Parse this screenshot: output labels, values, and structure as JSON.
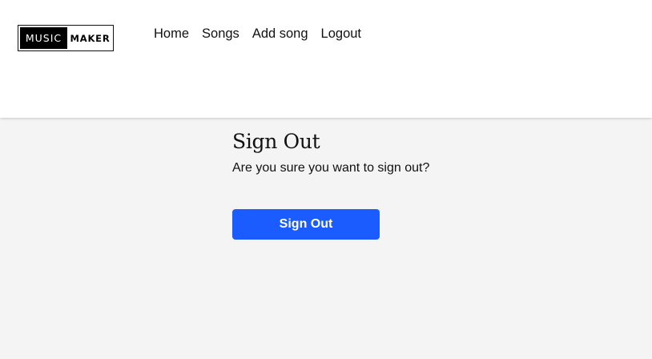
{
  "logo": {
    "left": "MUSIC",
    "right": "MAKER"
  },
  "nav": {
    "items": [
      {
        "label": "Home"
      },
      {
        "label": "Songs"
      },
      {
        "label": "Add song"
      },
      {
        "label": "Logout"
      }
    ]
  },
  "main": {
    "title": "Sign Out",
    "message": "Are you sure you want to sign out?",
    "button_label": "Sign Out"
  },
  "colors": {
    "accent": "#1a5cff",
    "page_background": "#f4f4f4",
    "header_background": "#ffffff"
  }
}
